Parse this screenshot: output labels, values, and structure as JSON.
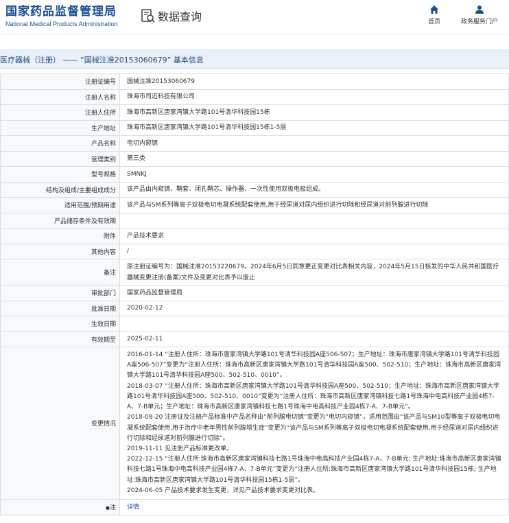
{
  "header": {
    "logo_cn": "国家药品监督管理局",
    "logo_en": "National Medical Products Administration",
    "data_query_label": "数据查询",
    "nav": {
      "home_label": "首页",
      "home_icon": "home-icon",
      "personal_label": "政务服务门户",
      "personal_icon": "user-icon"
    }
  },
  "title": "医疗器械（注册） —— “国械注准20153060679” 基本信息",
  "rows": [
    {
      "label": "注册证编号",
      "value": "国械注准20153060679"
    },
    {
      "label": "注册人名称",
      "value": "珠海市司迈科技有限公司"
    },
    {
      "label": "注册人住所",
      "value": "珠海市高新区唐家湾镇大学路101号清华科技园15栋"
    },
    {
      "label": "生产地址",
      "value": "珠海市高新区唐家湾镇大学路101号清华科技园15栋1-5层"
    },
    {
      "label": "产品名称",
      "value": "电切内窥镜"
    },
    {
      "label": "管理类别",
      "value": "第三类"
    },
    {
      "label": "型号规格",
      "value": "SMNKJ"
    },
    {
      "label": "结构及组成/主要组成成分",
      "value": "该产品由内窥镜、鞘套、闭孔鞘芯、操作器、一次性使用双极电极组成。"
    },
    {
      "label": "适用范围/预期用途",
      "value": "该产品与SM系列等离子双极电切电凝系统配套使用,用于经尿道对尿内组织进行切除和经尿道对前列腺进行切除"
    },
    {
      "label": "产品储存条件及有效期",
      "value": ""
    },
    {
      "label": "附件",
      "value": "产品技术要求"
    },
    {
      "label": "其他内容",
      "value": "/"
    }
  ],
  "note": {
    "label": "备注",
    "value": "原注册证编号为：国械注准20153220679。2024年6月5日同意更正变更对比表相关内容，2024年5月15日核发的中华人民共和国医疗器械变更注册(备案)文件及变更对比表予以废止"
  },
  "rows2": [
    {
      "label": "审批部门",
      "value": "国家药品监督管理局"
    },
    {
      "label": "批准日期",
      "value": "2020-02-12"
    },
    {
      "label": "生效日期",
      "value": ""
    },
    {
      "label": "有效期至",
      "value": "2025-02-11"
    }
  ],
  "change": {
    "label": "变更情况",
    "entries": [
      "2016-01-14 “注册人住所：珠海市唐家湾镇大学路101号清华科技园A座506-507；生产地址：珠海市唐家湾镇大学路101号清华科技园A座506-507”变更为“注册人住所：珠海市高新区唐家湾镇大学路101号清华科技园A座500、502-510；生产地址：珠海市高新区唐家湾镇大学路101号清华科技园A座500、502-510、0010”。",
      "2018-03-07 “注册人住所：珠海市高新区唐家湾镇大学路101号清华科技园A座500、502-510；生产地址：珠海市高新区唐家湾镇大学路101号清华科技园A座500、502-510、0010”变更为“注册人住所：珠海市高新区唐家湾镇科技七路1号珠海中电高科技产业园4栋7-A、7-B单元；生产地址：珠海市高新区唐家湾镇科技七路1号珠海中电高科技产业园4栋7-A、7-B单元”。",
      "2018-08-20 注册证及注册产品标准中产品名称由“前列腺电切镜”变更为“电切内窥镜”，适用范围由“该产品与SM10型等离子双极电切电凝系统配套使用,用于治疗中老年男性前列腺增生症”变更为“该产品与SM系列等离子双极电切电凝系统配套使用,用于经尿道对尿内组织进行切除和经尿道对前列腺进行切除”。",
      "2019-11-11 见注册产品标准更改单。",
      "2022-12-15 “注册人住所:珠海市高新区唐家湾镇科技七路1号珠海中电高科技产业园4栋7-A、7-B单元; 生产地址:珠海市高新区唐家湾镇科技七路1号珠海中电高科技产业园4栋7-A、7-B单元”变更为“注册人住所:珠海市高新区唐家湾镇大学路101号清华科技园15栋; 生产地址:珠海市高新区唐家湾镇大学路101号清华科技园15栋1-5层”。",
      "2024-06-05 产品技术要求发生变更，详见产品技术要求变更对比表。"
    ]
  },
  "footer_row": {
    "label_star": "●",
    "label": "注",
    "link": "详情"
  }
}
